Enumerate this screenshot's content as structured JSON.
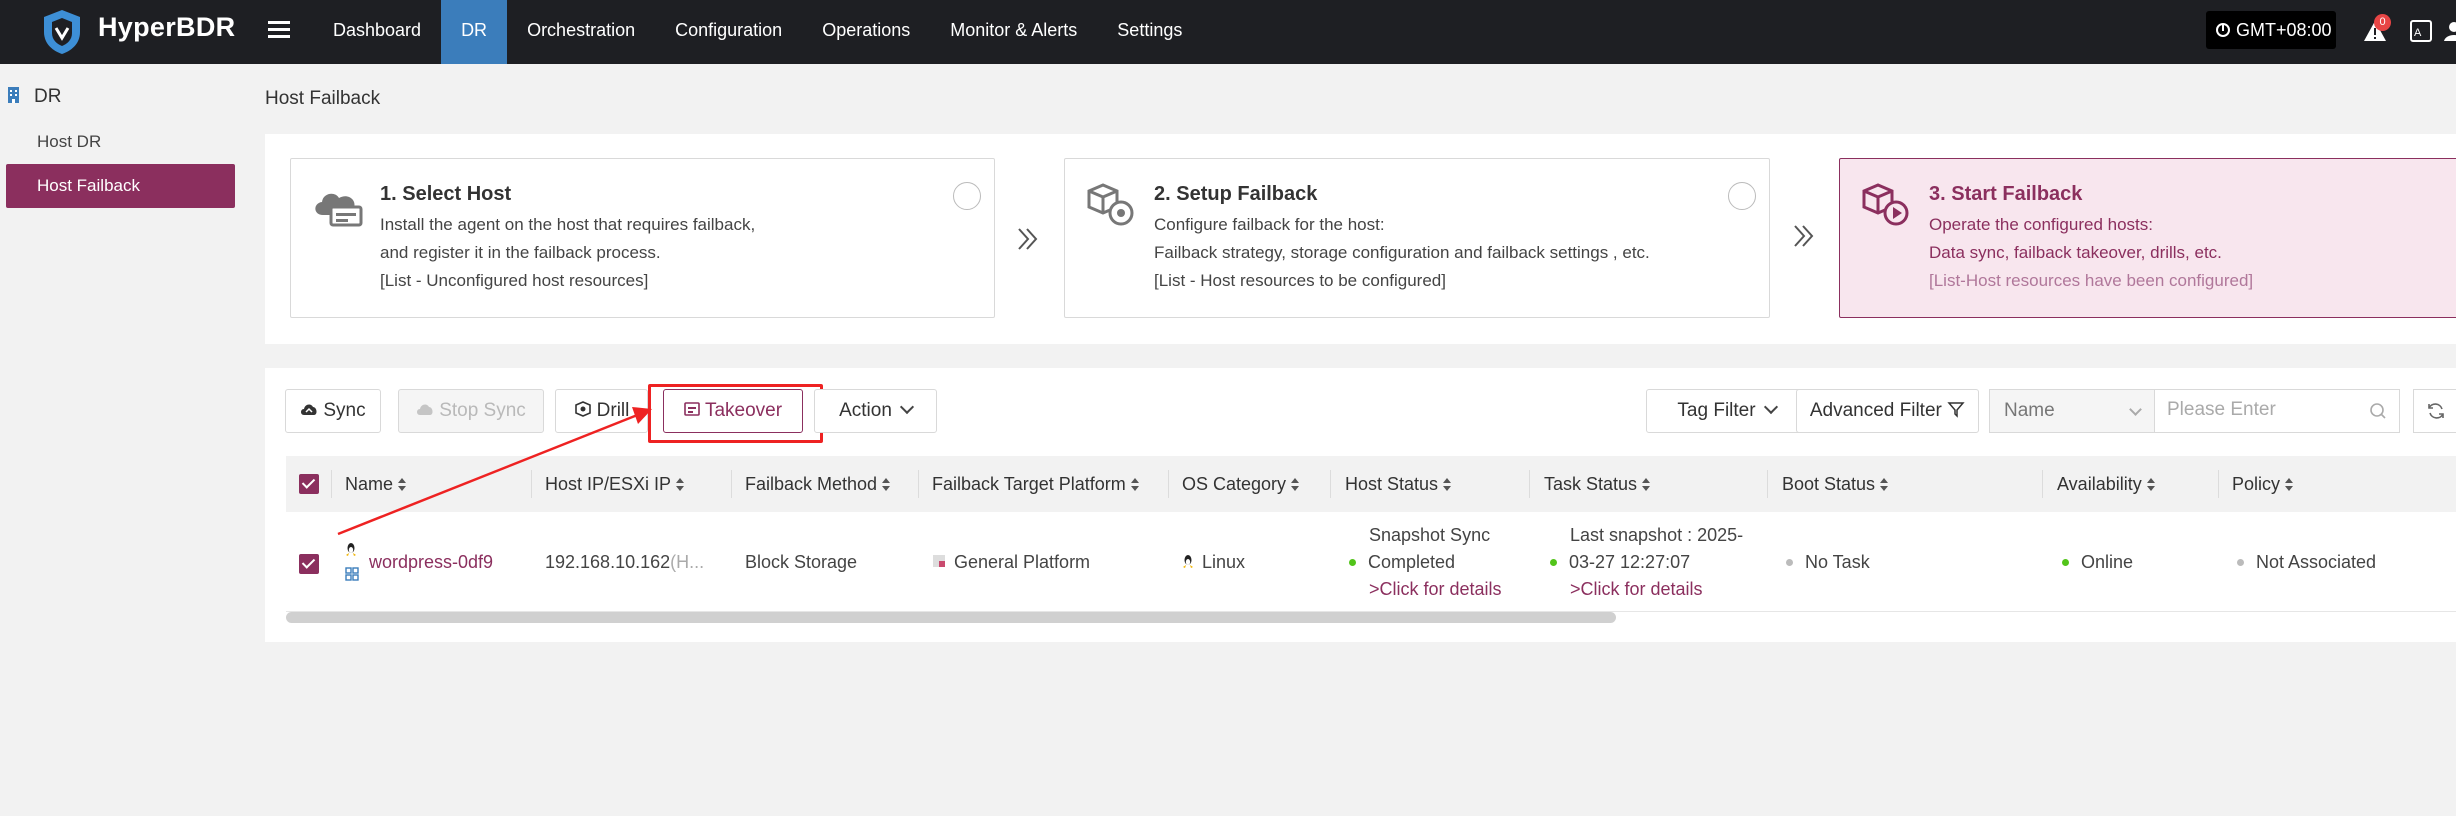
{
  "app": {
    "brand": "HyperBDR"
  },
  "nav": {
    "items": [
      "Dashboard",
      "DR",
      "Orchestration",
      "Configuration",
      "Operations",
      "Monitor & Alerts",
      "Settings"
    ],
    "active": "DR"
  },
  "header": {
    "timezone": "GMT+08:00",
    "alert_count": "0"
  },
  "sidebar": {
    "section": "DR",
    "items": [
      {
        "label": "Host DR",
        "active": false
      },
      {
        "label": "Host Failback",
        "active": true
      }
    ]
  },
  "page": {
    "title": "Host Failback"
  },
  "steps": [
    {
      "title": "1. Select Host",
      "lines": [
        "Install the agent on the host that requires failback,",
        "and register it in the failback process.",
        "[List - Unconfigured host resources]"
      ]
    },
    {
      "title": "2. Setup Failback",
      "lines": [
        "Configure failback for the host:",
        "Failback strategy, storage configuration and failback settings , etc.",
        "[List - Host resources to be configured]"
      ]
    },
    {
      "title": "3. Start Failback",
      "lines": [
        "Operate the configured hosts:",
        "Data sync, failback takeover, drills, etc.",
        "[List-Host resources have been configured]"
      ]
    }
  ],
  "toolbar": {
    "sync": "Sync",
    "stop_sync": "Stop Sync",
    "drill": "Drill",
    "takeover": "Takeover",
    "action": "Action",
    "tag_filter": "Tag Filter",
    "advanced_filter": "Advanced Filter"
  },
  "search": {
    "field": "Name",
    "placeholder": "Please Enter"
  },
  "table": {
    "columns": [
      "Name",
      "Host IP/ESXi IP",
      "Failback Method",
      "Failback Target Platform",
      "OS Category",
      "Host Status",
      "Task Status",
      "Boot Status",
      "Availability",
      "Policy"
    ],
    "rows": [
      {
        "name": "wordpress-0df9",
        "ip": "192.168.10.162",
        "ip_suffix": "(H...",
        "method": "Block Storage",
        "platform": "General Platform",
        "os": "Linux",
        "host_status_1": "Snapshot Sync",
        "host_status_2": "Completed",
        "host_status_link": ">Click for details",
        "task_status_1": "Last snapshot : 2025-",
        "task_status_2": "03-27 12:27:07",
        "task_status_link": ">Click for details",
        "boot_status": "No Task",
        "availability": "Online",
        "policy": "Not Associated"
      }
    ]
  },
  "colors": {
    "accent": "#8b2f5e",
    "nav_active": "#3b7dbb",
    "topbar": "#1e1f23",
    "highlight": "#ee2222",
    "online": "#52c41a"
  }
}
